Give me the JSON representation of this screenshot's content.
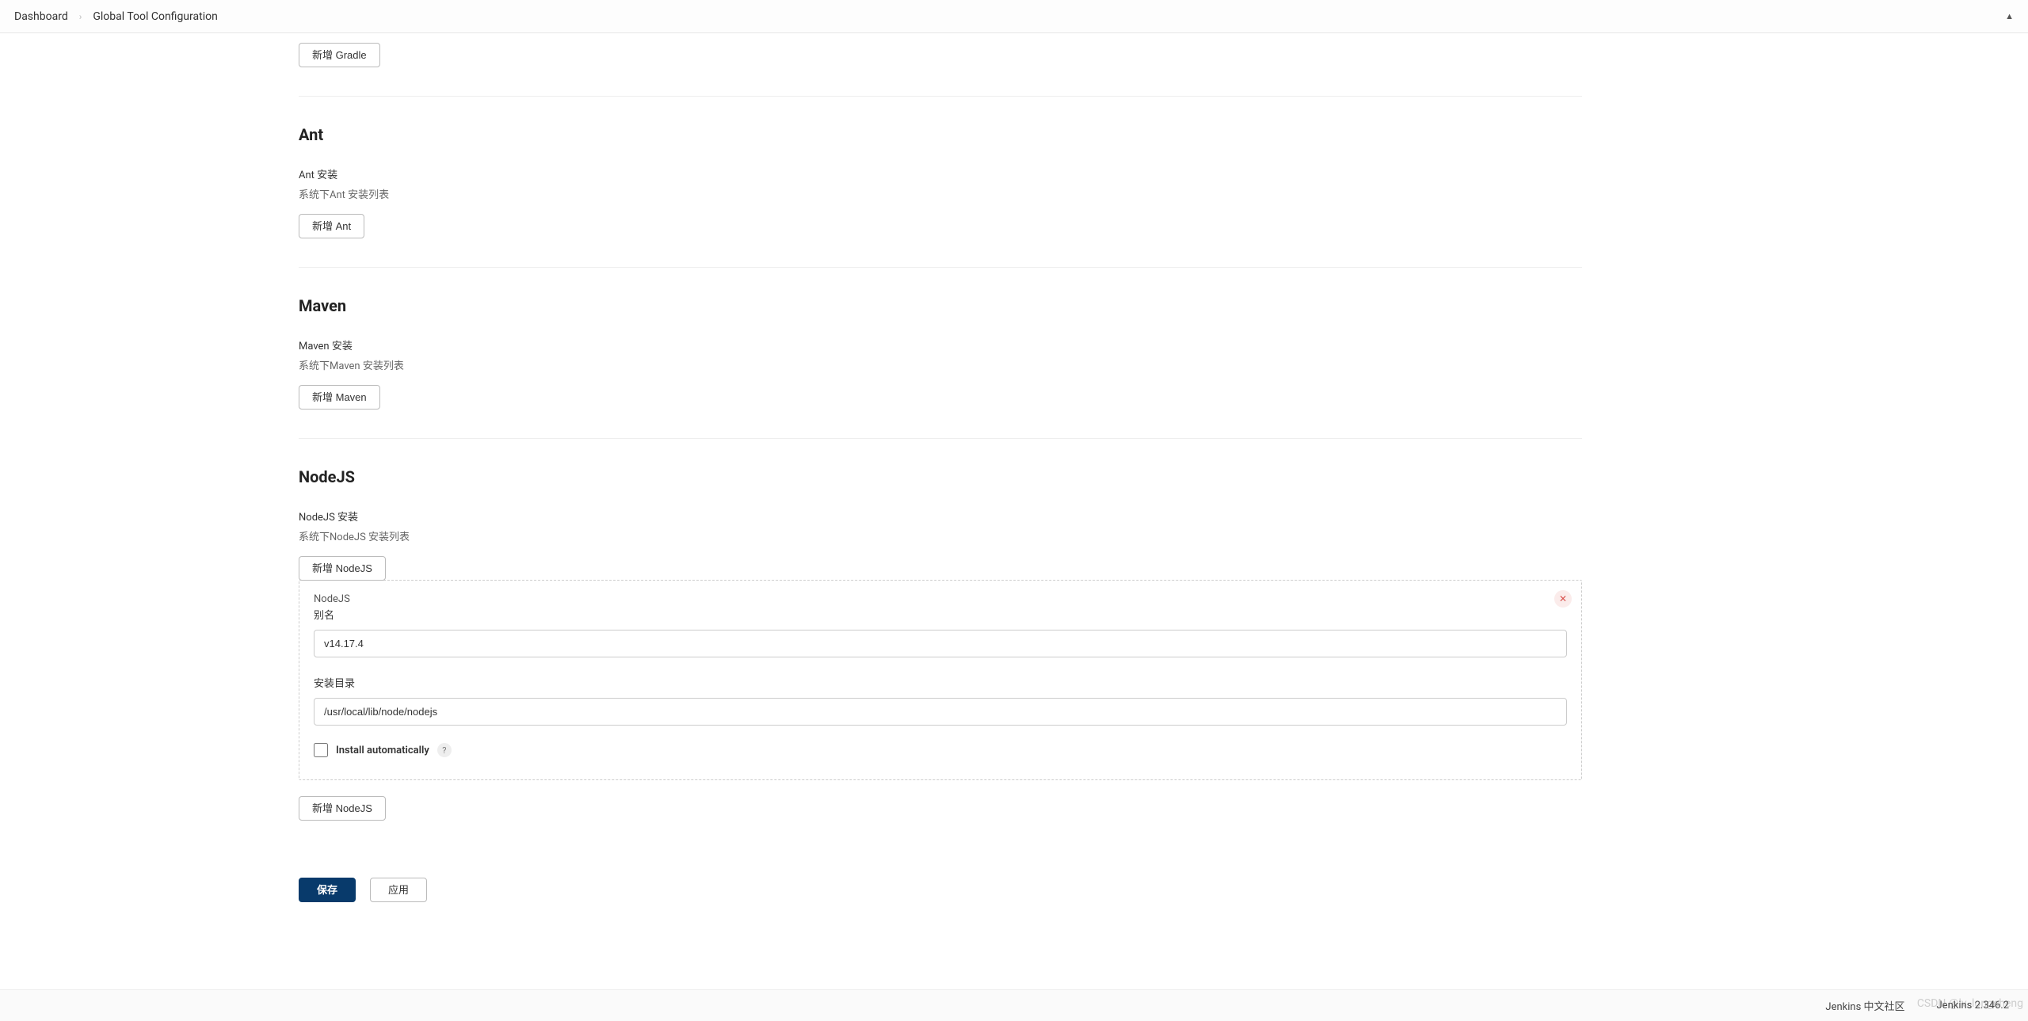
{
  "breadcrumb": {
    "items": [
      "Dashboard",
      "Global Tool Configuration"
    ]
  },
  "gradle": {
    "add_button": "新增 Gradle"
  },
  "ant": {
    "heading": "Ant",
    "install_label": "Ant 安装",
    "list_text": "系统下Ant 安装列表",
    "add_button": "新增 Ant"
  },
  "maven": {
    "heading": "Maven",
    "install_label": "Maven 安装",
    "list_text": "系统下Maven 安装列表",
    "add_button": "新增 Maven"
  },
  "nodejs": {
    "heading": "NodeJS",
    "install_label": "NodeJS 安装",
    "list_text": "系统下NodeJS 安装列表",
    "add_button_top": "新增 NodeJS",
    "chunk_label": "NodeJS",
    "name_label": "别名",
    "name_value": "v14.17.4",
    "home_label": "安装目录",
    "home_value": "/usr/local/lib/node/nodejs",
    "auto_install_label": "Install automatically",
    "help_char": "?",
    "add_button_bottom": "新增 NodeJS"
  },
  "actions": {
    "save": "保存",
    "apply": "应用"
  },
  "footer": {
    "community": "Jenkins 中文社区",
    "version": "Jenkins 2.346.2"
  },
  "watermark": "CSDN @lv_longcheng"
}
